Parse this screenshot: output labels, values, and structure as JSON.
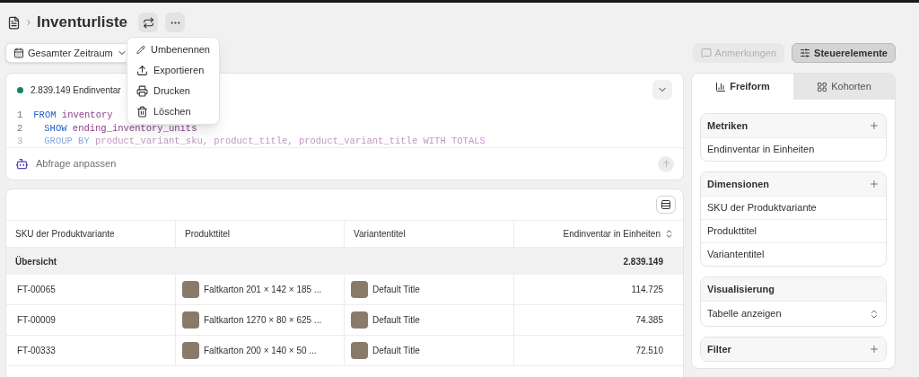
{
  "breadcrumb": {
    "title": "Inventurliste"
  },
  "menu": {
    "items": [
      {
        "kind": "rename",
        "label": "Umbenennen"
      },
      {
        "kind": "export",
        "label": "Exportieren"
      },
      {
        "kind": "print",
        "label": "Drucken"
      },
      {
        "kind": "delete",
        "label": "Löschen"
      }
    ]
  },
  "toolbar": {
    "date_range": "Gesamter Zeitraum",
    "buttons": [
      {
        "kind": "notes",
        "label": "Anmerkungen",
        "disabled": true,
        "pressed": false
      },
      {
        "kind": "controls",
        "label": "Steuerelemente",
        "disabled": false,
        "pressed": true
      }
    ]
  },
  "query": {
    "summary": "2.839.149 Endinventar",
    "code_lines": [
      {
        "number": "1",
        "keyword": "FROM",
        "rest": "inventory",
        "faded": false
      },
      {
        "number": "2",
        "keyword": "SHOW",
        "rest": "ending_inventory_units",
        "faded": false
      },
      {
        "number": "3",
        "keyword": "GROUP BY",
        "rest": "product_variant_sku, product_title, product_variant_title WITH TOTALS",
        "faded": true
      }
    ],
    "prompt_placeholder": "Abfrage anpassen"
  },
  "table": {
    "columns": [
      "SKU der Produktvariante",
      "Produkttitel",
      "Variantentitel",
      "Endinventar in Einheiten"
    ],
    "summary": {
      "label": "Übersicht",
      "total": "2.839.149"
    },
    "rows": [
      {
        "sku": "FT-00065",
        "product": "Faltkarton 201 × 142 × 185 ...",
        "variant": "Default Title",
        "units": "114.725"
      },
      {
        "sku": "FT-00009",
        "product": "Faltkarton 1270 × 80 × 625 ...",
        "variant": "Default Title",
        "units": "74.385"
      },
      {
        "sku": "FT-00333",
        "product": "Faltkarton 200 × 140 × 50 ...",
        "variant": "Default Title",
        "units": "72.510"
      }
    ]
  },
  "panel": {
    "tabs": [
      {
        "kind": "freeform",
        "label": "Freiform",
        "selected": true
      },
      {
        "kind": "cohorts",
        "label": "Kohorten",
        "selected": false
      }
    ],
    "sections": [
      {
        "kind": "list",
        "title": "Metriken",
        "items": [
          "Endinventar in Einheiten"
        ]
      },
      {
        "kind": "list",
        "title": "Dimensionen",
        "items": [
          "SKU der Produktvariante",
          "Produkttitel",
          "Variantentitel"
        ]
      },
      {
        "kind": "select",
        "title": "Visualisierung",
        "value": "Tabelle anzeigen"
      },
      {
        "kind": "add",
        "title": "Filter"
      }
    ]
  }
}
